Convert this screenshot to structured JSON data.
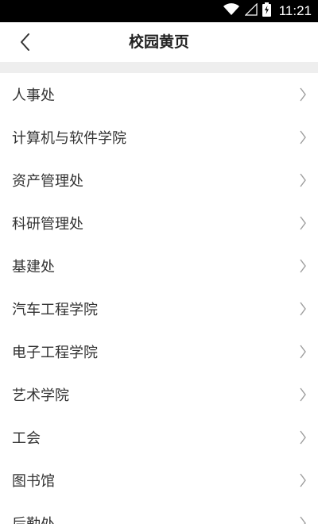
{
  "status_bar": {
    "time": "11:21",
    "icons": [
      "wifi-icon",
      "signal-icon",
      "battery-icon"
    ]
  },
  "app_bar": {
    "title": "校园黄页",
    "back_icon": "chevron-left-icon"
  },
  "list": {
    "items": [
      {
        "label": "人事处"
      },
      {
        "label": "计算机与软件学院"
      },
      {
        "label": "资产管理处"
      },
      {
        "label": "科研管理处"
      },
      {
        "label": "基建处"
      },
      {
        "label": "汽车工程学院"
      },
      {
        "label": "电子工程学院"
      },
      {
        "label": "艺术学院"
      },
      {
        "label": "工会"
      },
      {
        "label": "图书馆"
      },
      {
        "label": "后勤处"
      }
    ],
    "item_icon": "chevron-right-icon"
  },
  "colors": {
    "status_bar": "#000000",
    "background": "#ffffff",
    "divider": "#eeeeee",
    "text": "#333333",
    "chevron": "#9e9e9e"
  }
}
